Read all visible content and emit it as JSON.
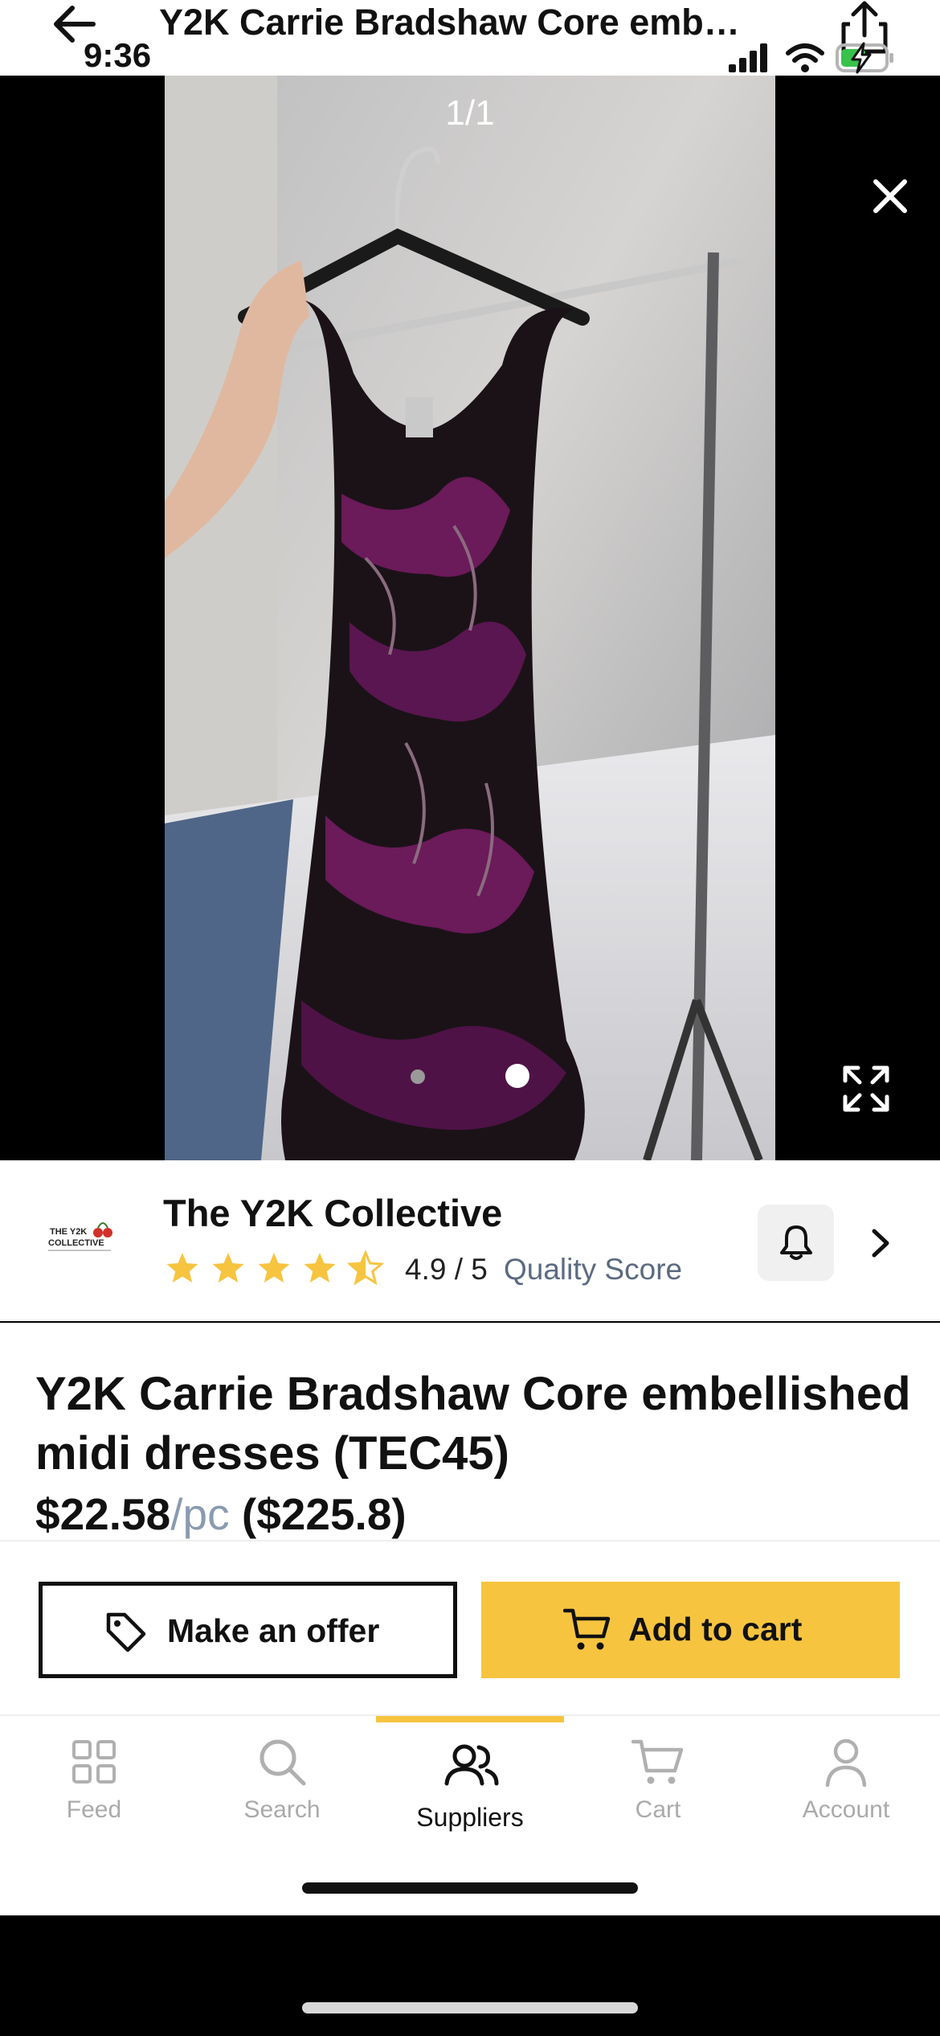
{
  "header": {
    "title": "Y2K Carrie Bradshaw Core emb…",
    "back_icon": "arrow-left-icon",
    "share_icon": "share-icon"
  },
  "status_bar": {
    "time": "9:36",
    "icons": [
      "cellular-signal-icon",
      "wifi-icon",
      "battery-charging-icon"
    ]
  },
  "viewer": {
    "counter": "1/1",
    "close_icon": "close-icon",
    "expand_icon": "expand-icon",
    "page_dots": 2,
    "active_dot": 2
  },
  "seller": {
    "name": "The Y2K Collective",
    "logo_text": "THE Y2K COLLECTIVE",
    "rating": 4.9,
    "rating_text": "4.9 / 5",
    "quality_label": "Quality Score",
    "star_color": "#f6c43f"
  },
  "product": {
    "title": "Y2K Carrie Bradshaw Core embellished midi dresses (TEC45)",
    "price": "$22.58",
    "unit": "/pc",
    "total": "($225.8)"
  },
  "actions": {
    "offer_label": "Make an offer",
    "cart_label": "Add to cart",
    "accent_color": "#f6c43f"
  },
  "tabs": [
    {
      "label": "Feed",
      "icon": "grid-icon"
    },
    {
      "label": "Search",
      "icon": "search-icon"
    },
    {
      "label": "Suppliers",
      "icon": "users-icon",
      "active": true
    },
    {
      "label": "Cart",
      "icon": "cart-icon"
    },
    {
      "label": "Account",
      "icon": "user-icon"
    }
  ]
}
